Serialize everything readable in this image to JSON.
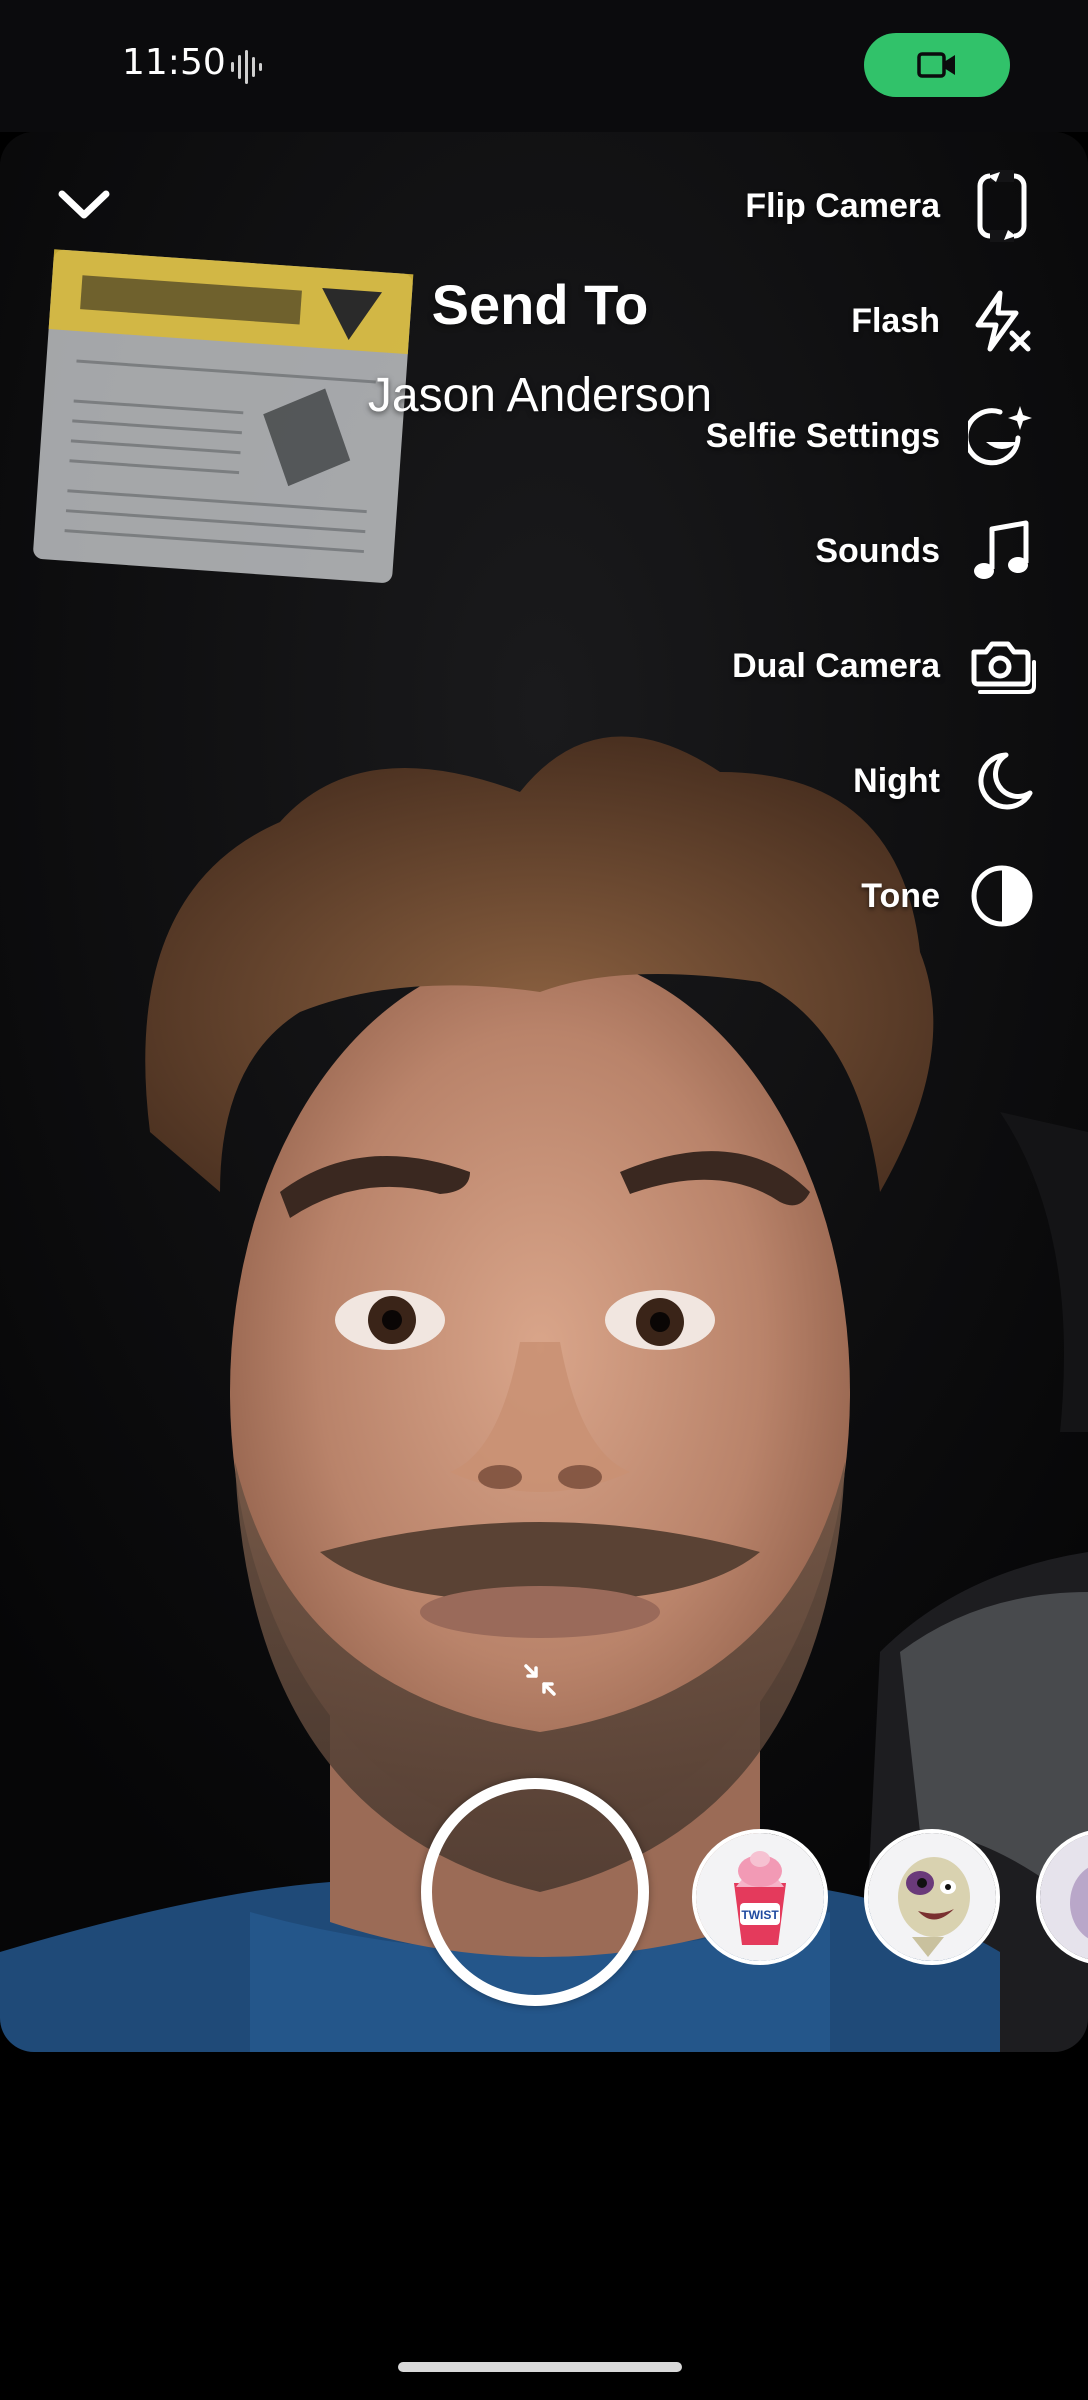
{
  "status_bar": {
    "time": "11:50"
  },
  "camera": {
    "send_to_label": "Send To",
    "recipient_name": "Jason Anderson"
  },
  "toolbar": {
    "items": [
      {
        "label": "Flip Camera",
        "icon": "flip-camera-icon"
      },
      {
        "label": "Flash",
        "icon": "flash-off-icon"
      },
      {
        "label": "Selfie Settings",
        "icon": "selfie-settings-icon"
      },
      {
        "label": "Sounds",
        "icon": "music-note-icon"
      },
      {
        "label": "Dual Camera",
        "icon": "dual-camera-icon"
      },
      {
        "label": "Night",
        "icon": "moon-icon"
      },
      {
        "label": "Tone",
        "icon": "tone-icon"
      }
    ]
  },
  "lenses": [
    {
      "name": "ice-cream-lens",
      "badge_text": "TWIST"
    },
    {
      "name": "sloth-lens"
    },
    {
      "name": "partial-lens"
    }
  ],
  "colors": {
    "record_pill": "#31c26a",
    "status_bar_bg": "#0b0b0d"
  }
}
